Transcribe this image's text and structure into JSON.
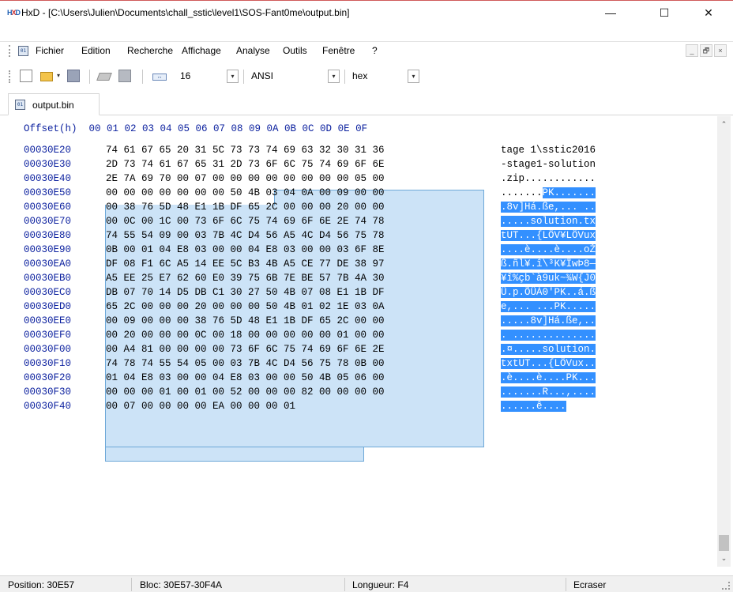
{
  "window": {
    "title": "HxD - [C:\\Users\\Julien\\Documents\\chall_sstic\\level1\\SOS-Fant0me\\output.bin]",
    "minimize_glyph": "—",
    "maximize_glyph": "☐",
    "close_glyph": "✕"
  },
  "menu": {
    "items": [
      "Fichier",
      "Edition",
      "Recherche",
      "Affichage",
      "Analyse",
      "Outils",
      "Fenêtre",
      "?"
    ],
    "mdi_minimize": "_",
    "mdi_restore": "🗗",
    "mdi_close": "×"
  },
  "toolbar": {
    "bytes_per_row": "16",
    "charset": "ANSI",
    "offset_base": "hex",
    "dropdown_glyph": "▾"
  },
  "tab": {
    "label": "output.bin"
  },
  "hex_view": {
    "header": "Offset(h)  00 01 02 03 04 05 06 07 08 09 0A 0B 0C 0D 0E 0F",
    "rows": [
      {
        "offset": "00030E20",
        "hex": "74 61 67 65 20 31 5C 73 73 74 69 63 32 30 31 36",
        "text_plain": "tage 1\\sstic2016",
        "text_sel": ""
      },
      {
        "offset": "00030E30",
        "hex": "2D 73 74 61 67 65 31 2D 73 6F 6C 75 74 69 6F 6E",
        "text_plain": "-stage1-solution",
        "text_sel": ""
      },
      {
        "offset": "00030E40",
        "hex": "2E 7A 69 70 00 07 00 00 00 00 00 00 00 00 05 00",
        "text_plain": ".zip............",
        "text_sel": ""
      },
      {
        "offset": "00030E50",
        "hex": "00 00 00 00 00 00 00 50 4B 03 04 0A 00 09 00 00",
        "text_plain": ".......",
        "text_sel": "PK......."
      },
      {
        "offset": "00030E60",
        "hex": "00 38 76 5D 48 E1 1B DF 65 2C 00 00 00 20 00 00",
        "text_plain": "",
        "text_sel": ".8v]Há.ße,... .."
      },
      {
        "offset": "00030E70",
        "hex": "00 0C 00 1C 00 73 6F 6C 75 74 69 6F 6E 2E 74 78",
        "text_plain": "",
        "text_sel": ".....solution.tx"
      },
      {
        "offset": "00030E80",
        "hex": "74 55 54 09 00 03 7B 4C D4 56 A5 4C D4 56 75 78",
        "text_plain": "",
        "text_sel": "tUT...{LÔV¥LÔVux"
      },
      {
        "offset": "00030E90",
        "hex": "0B 00 01 04 E8 03 00 00 04 E8 03 00 00 03 6F 8E",
        "text_plain": "",
        "text_sel": "....è....è....oŽ"
      },
      {
        "offset": "00030EA0",
        "hex": "DF 08 F1 6C A5 14 EE 5C B3 4B A5 CE 77 DE 38 97",
        "text_plain": "",
        "text_sel": "ß.ñl¥.î\\³K¥ÎwÞ8—"
      },
      {
        "offset": "00030EB0",
        "hex": "A5 EE 25 E7 62 60 E0 39 75 6B 7E BE 57 7B 4A 30",
        "text_plain": "",
        "text_sel": "¥î%çb`à9uk~¾W{J0"
      },
      {
        "offset": "00030EC0",
        "hex": "DB 07 70 14 D5 DB C1 30 27 50 4B 07 08 E1 1B DF",
        "text_plain": "",
        "text_sel": "Û.p.ÕÛÁ0'PK..á.ß"
      },
      {
        "offset": "00030ED0",
        "hex": "65 2C 00 00 00 20 00 00 00 50 4B 01 02 1E 03 0A",
        "text_plain": "",
        "text_sel": "e,... ...PK....."
      },
      {
        "offset": "00030EE0",
        "hex": "00 09 00 00 00 38 76 5D 48 E1 1B DF 65 2C 00 00",
        "text_plain": "",
        "text_sel": ".....8v]Há.ße,.."
      },
      {
        "offset": "00030EF0",
        "hex": "00 20 00 00 00 0C 00 18 00 00 00 00 00 01 00 00",
        "text_plain": "",
        "text_sel": ". .............."
      },
      {
        "offset": "00030F00",
        "hex": "00 A4 81 00 00 00 00 73 6F 6C 75 74 69 6F 6E 2E",
        "text_plain": "",
        "text_sel": ".¤.....solution."
      },
      {
        "offset": "00030F10",
        "hex": "74 78 74 55 54 05 00 03 7B 4C D4 56 75 78 0B 00",
        "text_plain": "",
        "text_sel": "txtUT...{LÔVux.."
      },
      {
        "offset": "00030F20",
        "hex": "01 04 E8 03 00 00 04 E8 03 00 00 50 4B 05 06 00",
        "text_plain": "",
        "text_sel": ".è....è....PK..."
      },
      {
        "offset": "00030F30",
        "hex": "00 00 00 01 00 01 00 52 00 00 00 82 00 00 00 00",
        "text_plain": "",
        "text_sel": ".......R...,...."
      },
      {
        "offset": "00030F40",
        "hex": "00 07 00 00 00 00 EA 00 00 00 01",
        "text_plain": "",
        "text_sel": "......ê...."
      }
    ]
  },
  "scrollbar": {
    "up_glyph": "⌃",
    "down_glyph": "⌄"
  },
  "statusbar": {
    "position": "Position: 30E57",
    "bloc": "Bloc: 30E57-30F4A",
    "longueur": "Longueur: F4",
    "mode": "Ecraser"
  }
}
